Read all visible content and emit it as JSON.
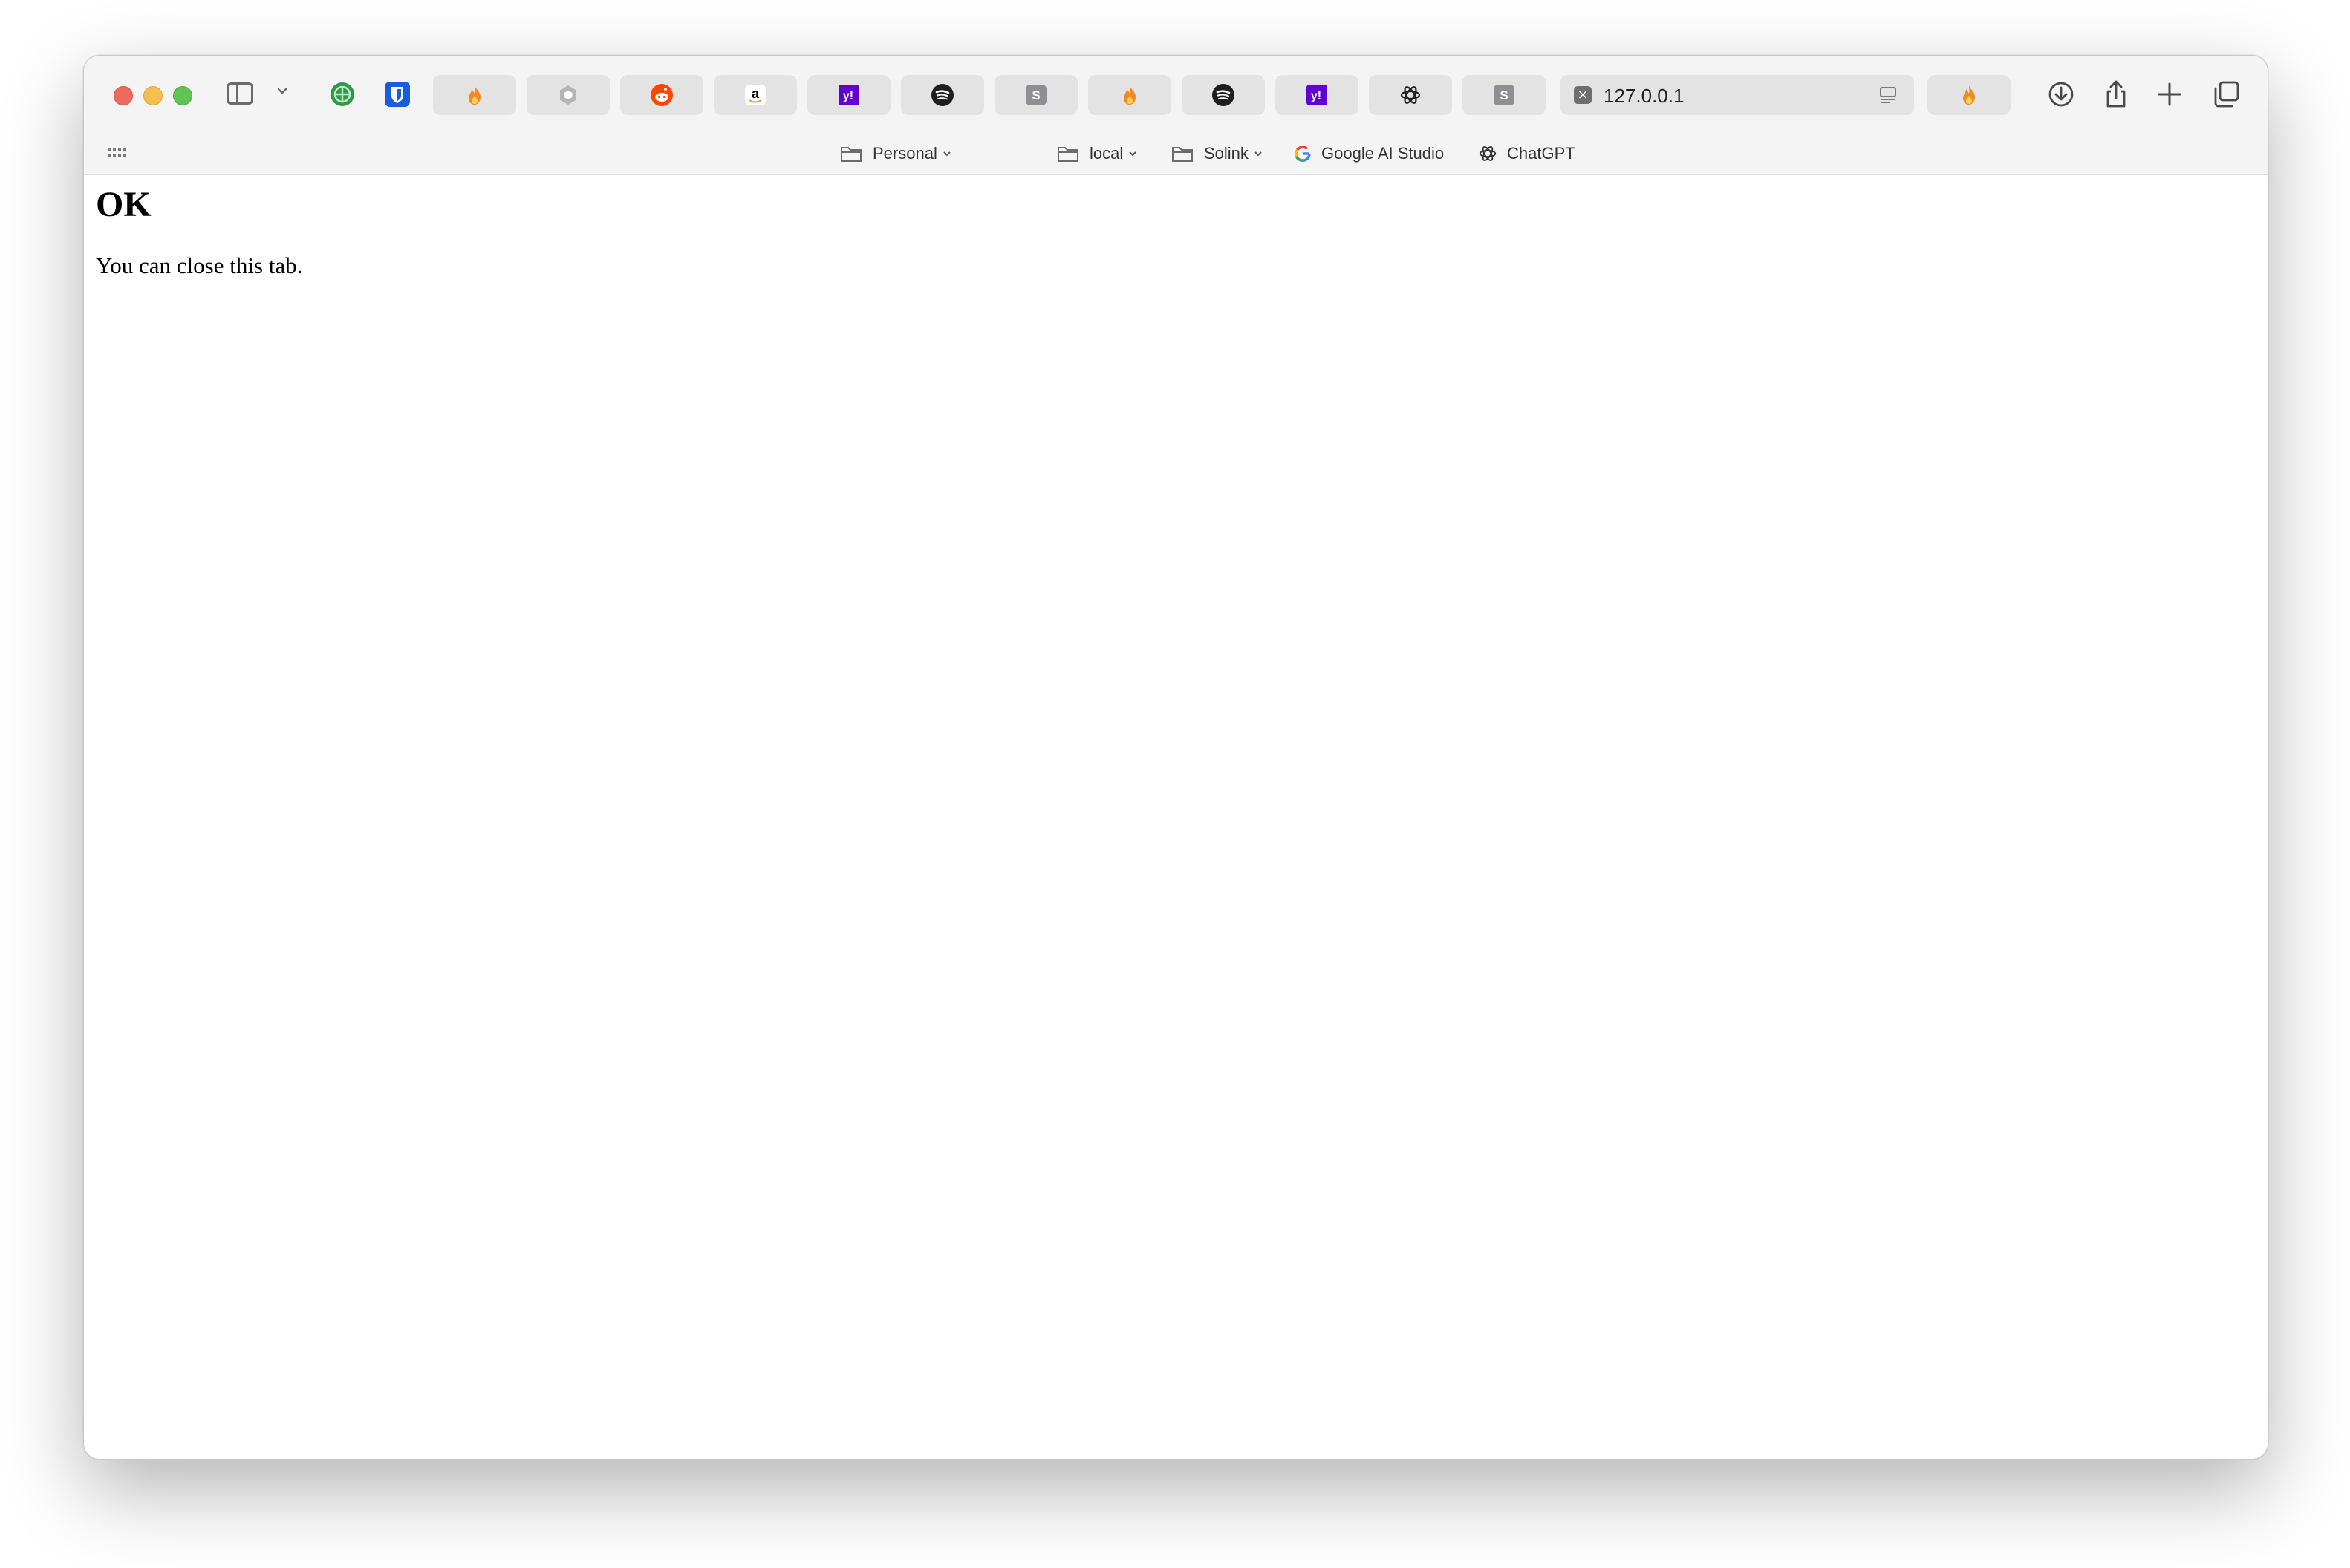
{
  "browser": {
    "tabs": [
      {
        "icon": "fire-icon",
        "color": "#f08a24"
      },
      {
        "icon": "hexagon-icon",
        "color": "#b5b5b5"
      },
      {
        "icon": "reddit-icon",
        "color": "#ff4500"
      },
      {
        "icon": "amazon-icon",
        "color": "#000000"
      },
      {
        "icon": "yahoo-icon",
        "color": "#6001d2"
      },
      {
        "icon": "spotify-icon",
        "color": "#1e1e1e"
      },
      {
        "icon": "s-icon",
        "label": "S",
        "color": "#8e8e93"
      },
      {
        "icon": "fire-icon",
        "color": "#f08a24"
      },
      {
        "icon": "spotify-icon",
        "color": "#1e1e1e"
      },
      {
        "icon": "yahoo-icon",
        "color": "#6001d2"
      },
      {
        "icon": "openai-icon",
        "color": "#1e1e1e"
      },
      {
        "icon": "s-icon",
        "label": "S",
        "color": "#8e8e93"
      }
    ],
    "pinned": [
      {
        "icon": "globe-green-icon",
        "color": "#2e9a4a"
      },
      {
        "icon": "bitwarden-icon",
        "color": "#175ddc"
      }
    ],
    "active_tab": {
      "url": "127.0.0.1"
    },
    "extra_tab": {
      "icon": "fire-icon",
      "color": "#f08a24"
    },
    "bookmarks": {
      "personal": "Personal",
      "local": "local",
      "solink": "Solink",
      "google_ai_studio": "Google AI Studio",
      "chatgpt": "ChatGPT"
    }
  },
  "page": {
    "heading": "OK",
    "message": "You can close this tab."
  }
}
